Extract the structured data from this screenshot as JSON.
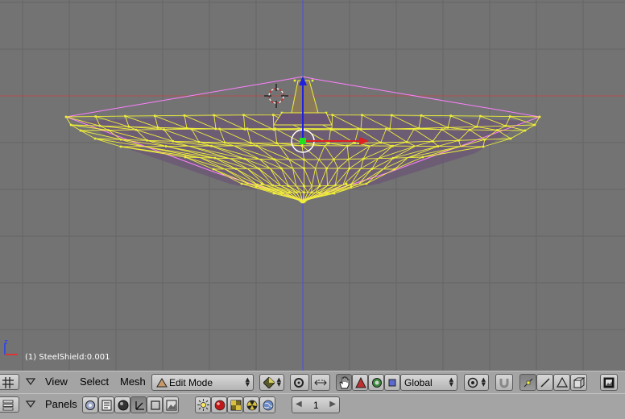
{
  "viewport": {
    "info": "(1) SteelShield:0.001",
    "axes": {
      "z_label": "z"
    }
  },
  "header1": {
    "view_label": "View",
    "select_label": "Select",
    "mesh_label": "Mesh",
    "mode_label": "Edit Mode",
    "orientation_label": "Global"
  },
  "header2": {
    "panels_label": "Panels",
    "frame_value": "1"
  },
  "colors": {
    "viewport_bg": "#737373",
    "wire": "#f0ef3a",
    "cage": "#ff80ff",
    "header_bg": "#a4a4a4"
  },
  "icons": [
    "grid-editor-icon",
    "menu-arrow-icon",
    "edit-mode-icon",
    "shading-icon",
    "pivot-icon",
    "manipulator-hand-icon",
    "translate-icon",
    "rotate-icon",
    "scale-icon",
    "snap-icon",
    "magnet-icon",
    "vertex-select-icon",
    "edge-select-icon",
    "face-select-icon",
    "occlude-icon",
    "render-icon",
    "panels-icon",
    "lamp-icon",
    "material-icon",
    "texture-icon",
    "radiation-icon",
    "world-icon"
  ]
}
